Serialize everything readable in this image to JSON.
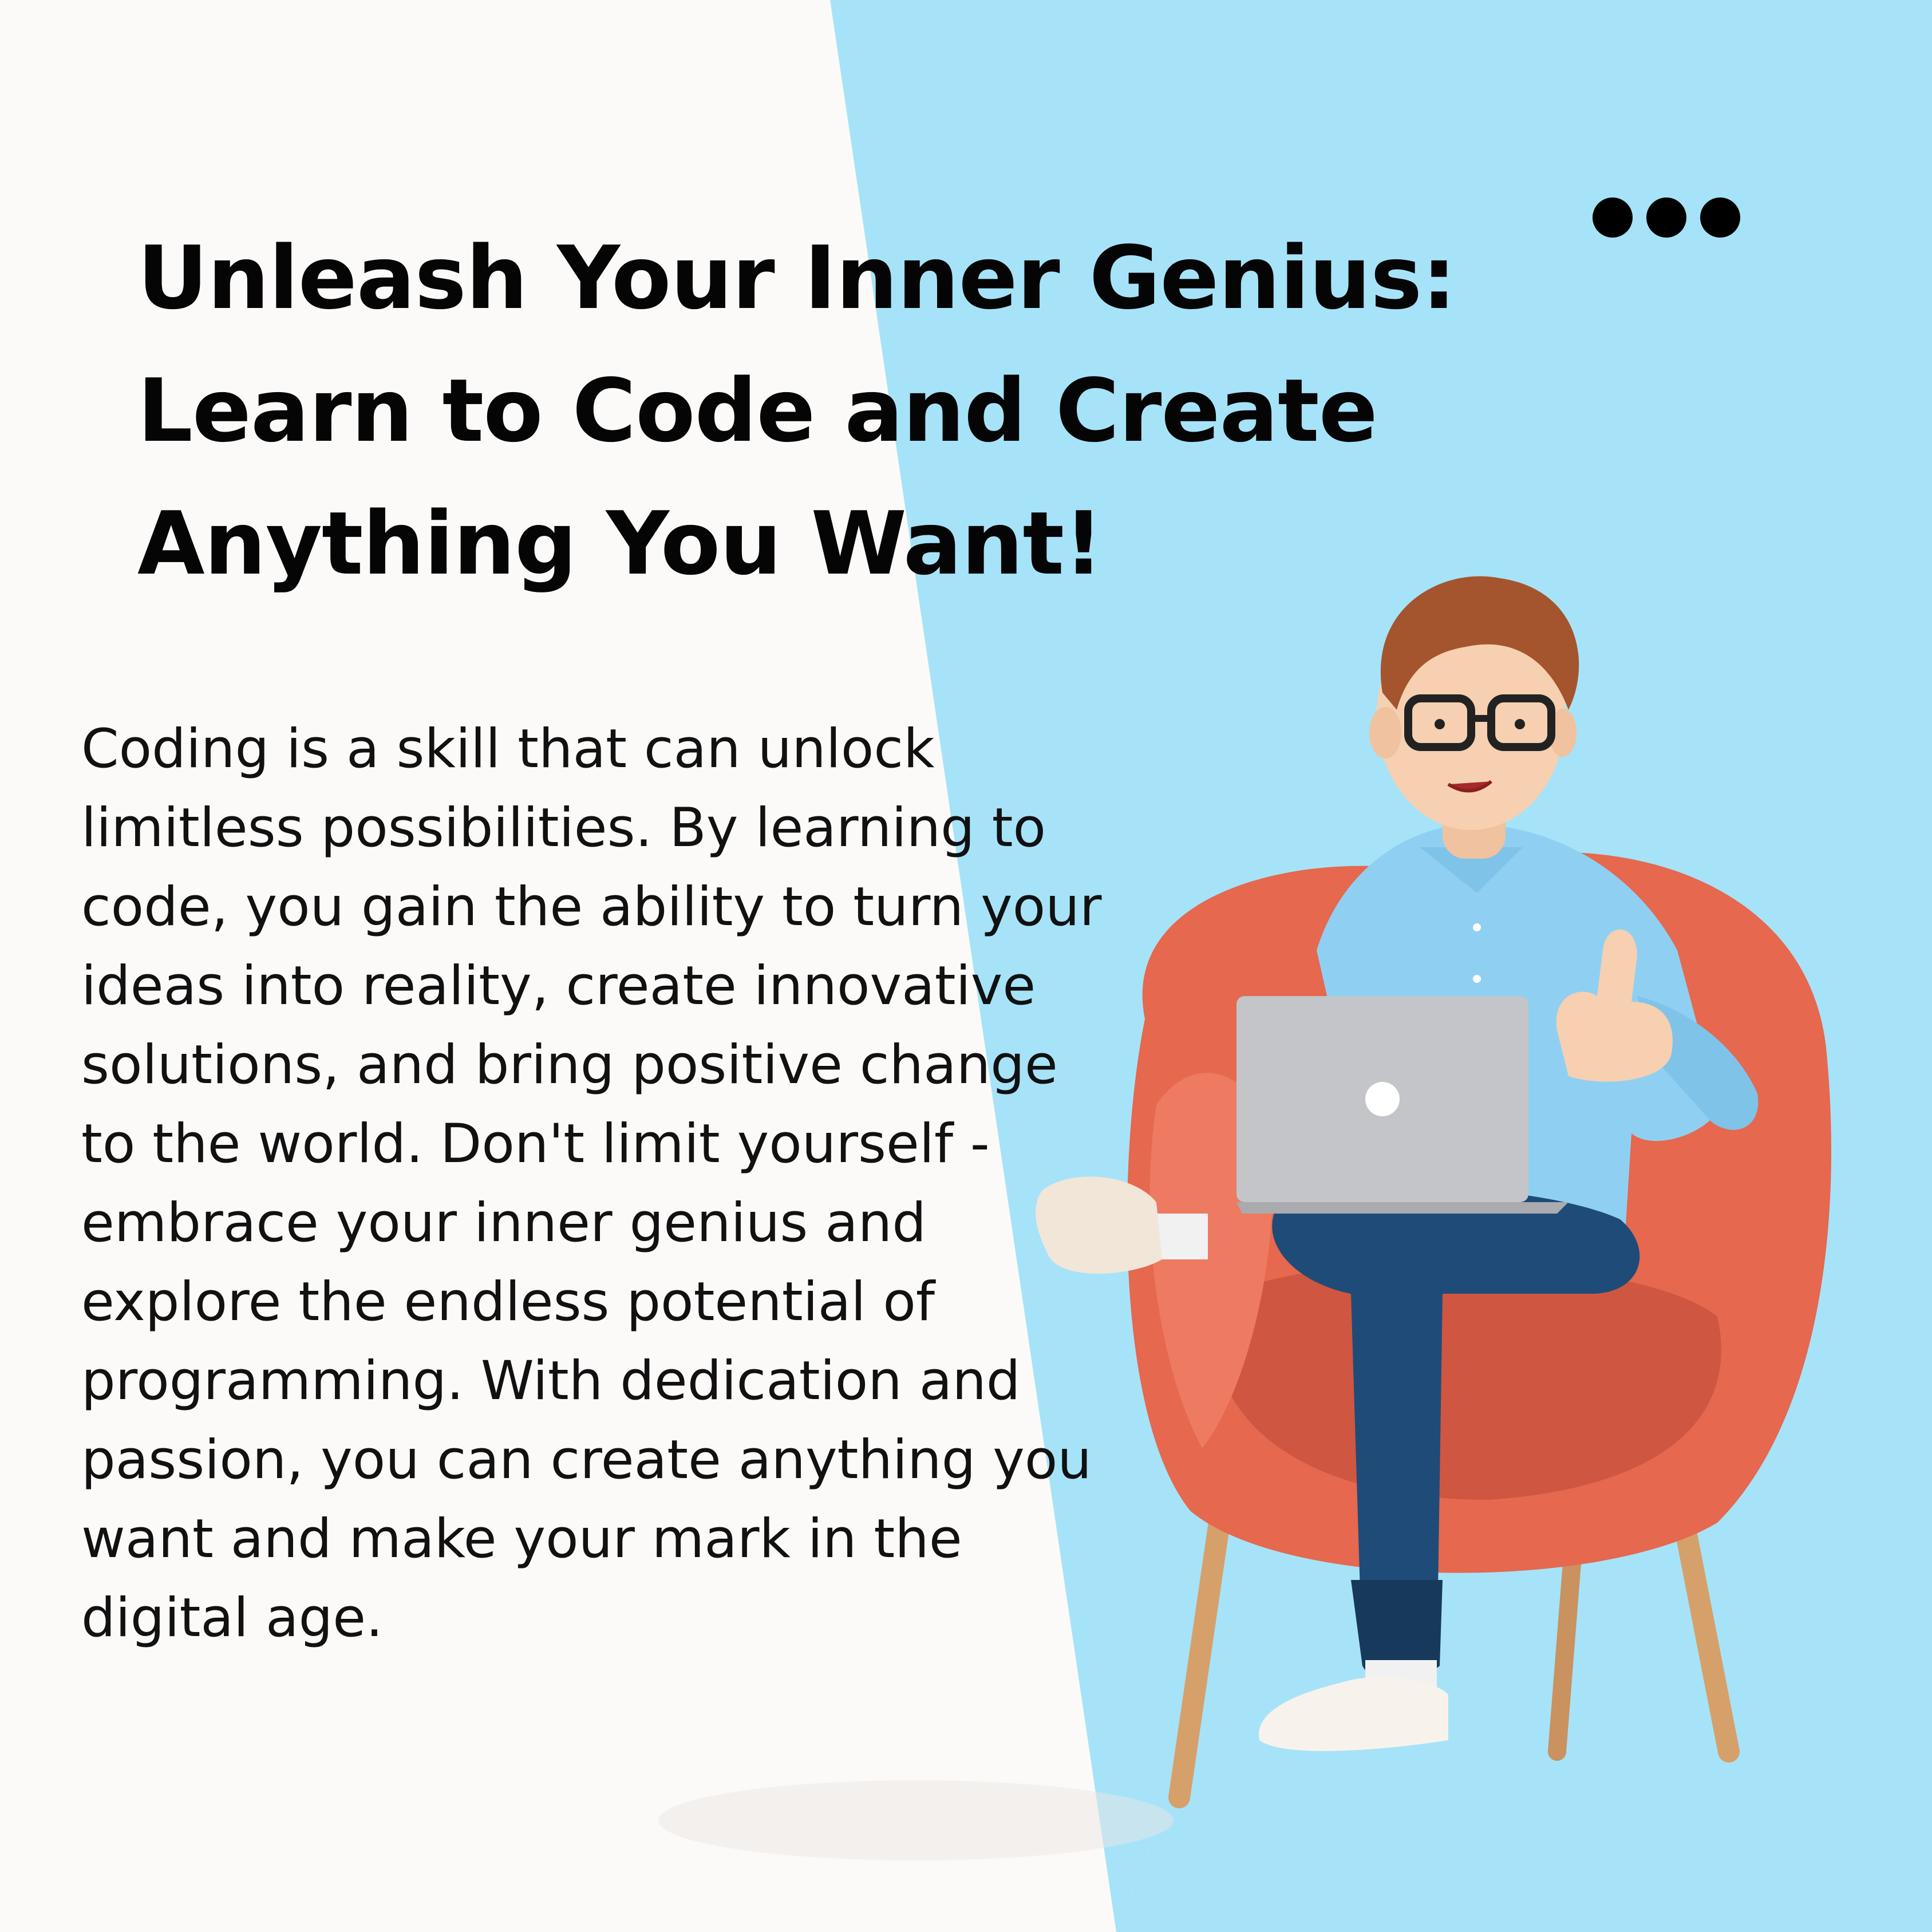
{
  "colors": {
    "background_left": "#fcfaf8",
    "background_right": "#a6e3f8",
    "text": "#050505",
    "chair": "#e5684f",
    "shirt": "#8fd0f2",
    "pants": "#1f4b78",
    "laptop": "#c3c5c9",
    "hair": "#a4552d",
    "skin": "#f6d0b0"
  },
  "menu": {
    "icon": "more-dots-icon"
  },
  "headline": {
    "line1": "Unleash Your Inner Genius:",
    "line2": "Learn to Code and Create",
    "line3": "Anything You Want!"
  },
  "body": {
    "lines": [
      "Coding is a skill that can unlock",
      "limitless possibilities. By learning to",
      "code, you gain the ability to turn your",
      "ideas into reality, create innovative",
      "solutions, and bring positive change",
      "to the world. Don't limit yourself -",
      "embrace your inner genius and",
      "explore the endless potential of",
      "programming. With dedication and",
      "passion, you can create anything you",
      "want and make your mark in the",
      "digital age."
    ]
  }
}
